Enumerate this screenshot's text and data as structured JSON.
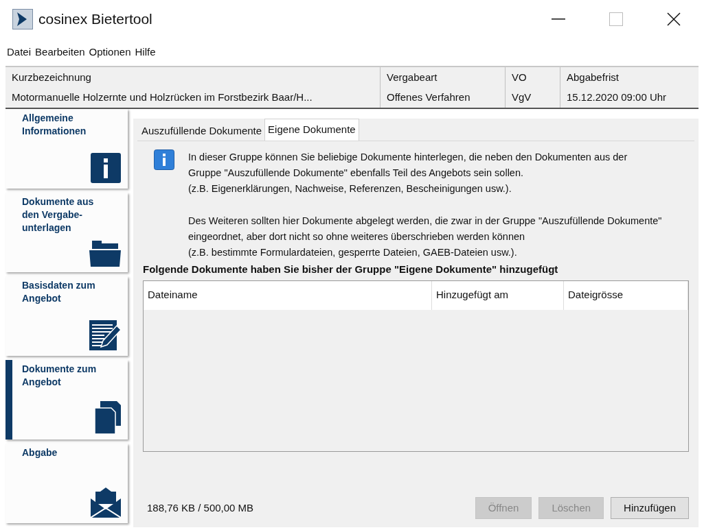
{
  "window": {
    "title": "cosinex Bietertool"
  },
  "menu": [
    "Datei",
    "Bearbeiten",
    "Optionen",
    "Hilfe"
  ],
  "header": [
    {
      "label": "Kurzbezeichnung",
      "value": "Motormanuelle Holzernte und Holzrücken im Forstbezirk Baar/H..."
    },
    {
      "label": "Vergabeart",
      "value": "Offenes Verfahren"
    },
    {
      "label": "VO",
      "value": "VgV"
    },
    {
      "label": "Abgabefrist",
      "value": "15.12.2020 09:00 Uhr"
    }
  ],
  "sidebar": {
    "items": [
      {
        "label": "Allgemeine Informationen",
        "kind": "info",
        "selected": false
      },
      {
        "label": "Dokumente aus den Vergabe-unterlagen",
        "kind": "folder",
        "selected": false
      },
      {
        "label": "Basisdaten zum Angebot",
        "kind": "form",
        "selected": false
      },
      {
        "label": "Dokumente zum Angebot",
        "kind": "documents",
        "selected": true
      },
      {
        "label": "Abgabe",
        "kind": "envelope",
        "selected": false
      }
    ]
  },
  "tabs": [
    {
      "label": "Auszufüllende Dokumente",
      "selected": false
    },
    {
      "label": "Eigene Dokumente",
      "selected": true
    }
  ],
  "info": {
    "paragraphs": [
      [
        "In dieser Gruppe können Sie beliebige Dokumente hinterlegen, die neben den Dokumenten aus der",
        "Gruppe \"Auszufüllende Dokumente\" ebenfalls Teil des Angebots sein sollen.",
        "(z.B. Eigenerklärungen, Nachweise, Referenzen, Bescheinigungen usw.)."
      ],
      [
        "Des Weiteren sollten hier Dokumente abgelegt werden, die zwar in der Gruppe \"Auszufüllende Dokumente\" eingeordnet, aber dort nicht so ohne weiteres überschrieben werden können",
        "(z.B. bestimmte Formulardateien, gesperrte Dateien, GAEB-Dateien usw.)."
      ]
    ]
  },
  "table": {
    "title": "Folgende Dokumente haben Sie bisher der Gruppe \"Eigene Dokumente\" hinzugefügt",
    "columns": [
      "Dateiname",
      "Hinzugefügt am",
      "Dateigrösse"
    ]
  },
  "status": "188,76 KB / 500,00 MB",
  "buttons": [
    {
      "label": "Öffnen",
      "disabled": true
    },
    {
      "label": "Löschen",
      "disabled": true
    },
    {
      "label": "Hinzufügen",
      "disabled": false
    }
  ]
}
